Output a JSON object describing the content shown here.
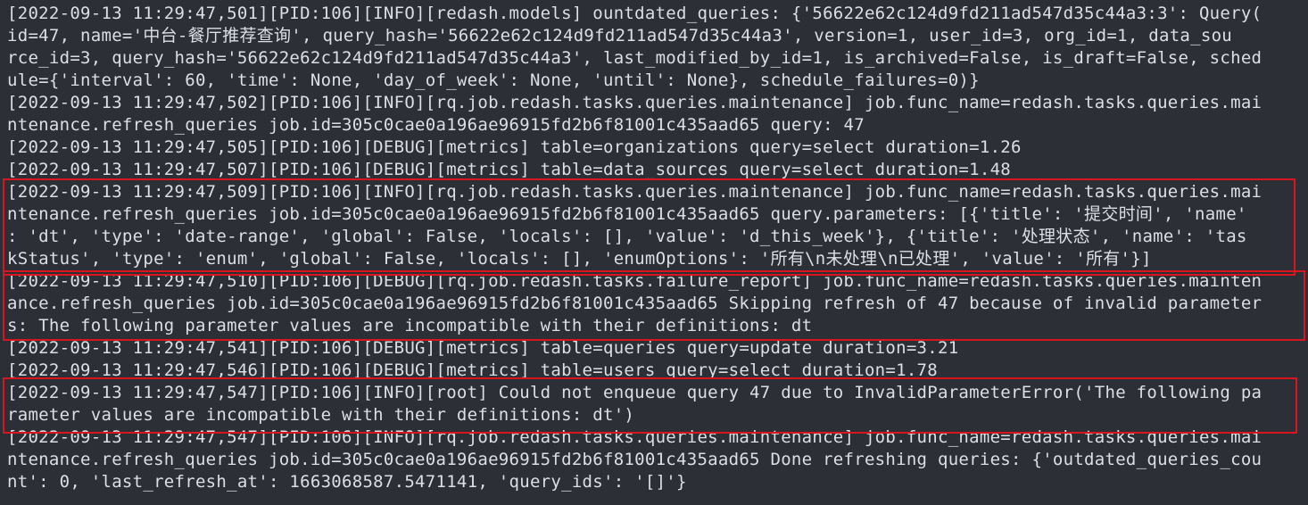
{
  "terminal": {
    "lines": [
      "[2022-09-13 11:29:47,501][PID:106][INFO][redash.models] ountdated_queries: {'56622e62c124d9fd211ad547d35c44a3:3': Query(",
      "id=47, name='中台-餐厅推荐查询', query_hash='56622e62c124d9fd211ad547d35c44a3', version=1, user_id=3, org_id=1, data_sou",
      "rce_id=3, query_hash='56622e62c124d9fd211ad547d35c44a3', last_modified_by_id=1, is_archived=False, is_draft=False, sched",
      "ule={'interval': 60, 'time': None, 'day_of_week': None, 'until': None}, schedule_failures=0)}",
      "[2022-09-13 11:29:47,502][PID:106][INFO][rq.job.redash.tasks.queries.maintenance] job.func_name=redash.tasks.queries.mai",
      "ntenance.refresh_queries job.id=305c0cae0a196ae96915fd2b6f81001c435aad65 query: 47",
      "[2022-09-13 11:29:47,505][PID:106][DEBUG][metrics] table=organizations query=select duration=1.26",
      "[2022-09-13 11:29:47,507][PID:106][DEBUG][metrics] table=data_sources query=select duration=1.48",
      "[2022-09-13 11:29:47,509][PID:106][INFO][rq.job.redash.tasks.queries.maintenance] job.func_name=redash.tasks.queries.mai",
      "ntenance.refresh_queries job.id=305c0cae0a196ae96915fd2b6f81001c435aad65 query.parameters: [{'title': '提交时间', 'name'",
      ": 'dt', 'type': 'date-range', 'global': False, 'locals': [], 'value': 'd_this_week'}, {'title': '处理状态', 'name': 'tas",
      "kStatus', 'type': 'enum', 'global': False, 'locals': [], 'enumOptions': '所有\\n未处理\\n已处理', 'value': '所有'}]",
      "[2022-09-13 11:29:47,510][PID:106][DEBUG][rq.job.redash.tasks.failure_report] job.func_name=redash.tasks.queries.mainten",
      "ance.refresh_queries job.id=305c0cae0a196ae96915fd2b6f81001c435aad65 Skipping refresh of 47 because of invalid parameter",
      "s: The following parameter values are incompatible with their definitions: dt",
      "[2022-09-13 11:29:47,541][PID:106][DEBUG][metrics] table=queries query=update duration=3.21",
      "[2022-09-13 11:29:47,546][PID:106][DEBUG][metrics] table=users query=select duration=1.78",
      "[2022-09-13 11:29:47,547][PID:106][INFO][root] Could not enqueue query 47 due to InvalidParameterError('The following pa",
      "rameter values are incompatible with their definitions: dt')",
      "[2022-09-13 11:29:47,547][PID:106][INFO][rq.job.redash.tasks.queries.maintenance] job.func_name=redash.tasks.queries.mai",
      "ntenance.refresh_queries job.id=305c0cae0a196ae96915fd2b6f81001c435aad65 Done refreshing queries: {'outdated_queries_cou",
      "nt': 0, 'last_refresh_at': 1663068587.5471141, 'query_ids': '[]'}"
    ]
  },
  "colors": {
    "background": "#2c2f36",
    "text": "#dcdfe4",
    "highlight_border": "#d9161f"
  }
}
